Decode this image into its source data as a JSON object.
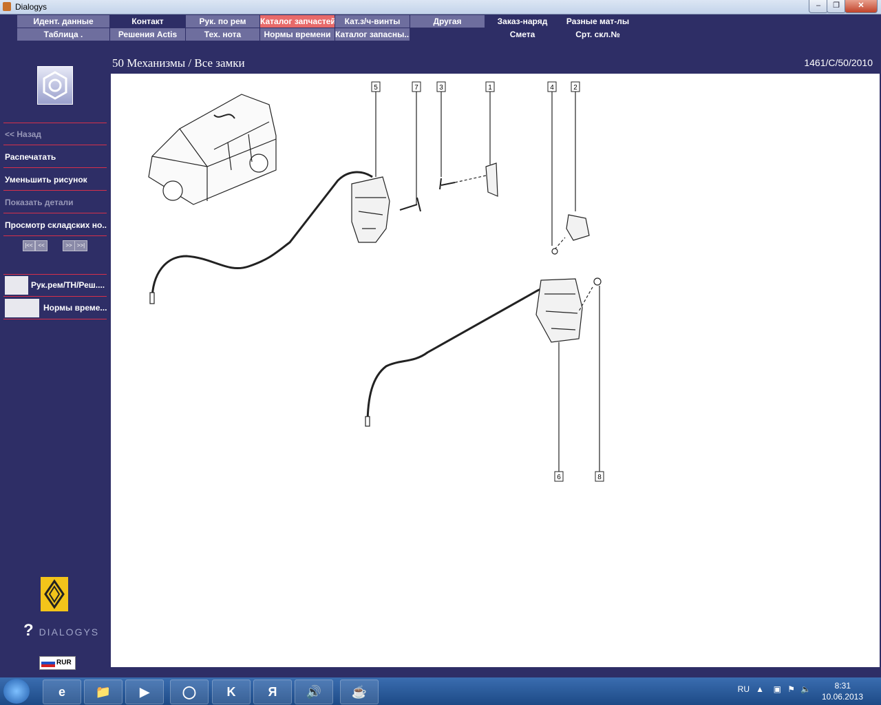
{
  "window": {
    "title": "Dialogys"
  },
  "menu": {
    "row1": [
      "Идент. данные",
      "Контакт",
      "Рук. по рем",
      "Каталог запчастей",
      "Кат.з/ч-винты",
      "Другая",
      "Заказ-наряд",
      "Разные мат-лы"
    ],
    "row2": [
      "Таблица .",
      "Решения Actis",
      "Тех. нота",
      "Нормы времени",
      "Каталог запасны...",
      "Смета",
      "Срт. скл.№"
    ],
    "active": "Каталог запчастей"
  },
  "header": {
    "breadcrumb": "50 Механизмы / Все замки",
    "reference": "1461/C/50/2010"
  },
  "sidebar": {
    "items": [
      {
        "label": "<< Назад"
      },
      {
        "label": "Распечатать"
      },
      {
        "label": "Уменьшить рисунок"
      },
      {
        "label": "Показать детали"
      },
      {
        "label": "Просмотр складских но..."
      }
    ],
    "pager": [
      "|<<",
      "<<",
      ">>",
      ">>|"
    ],
    "docs": [
      {
        "label": "Рук.рем/ТН/Реш...."
      },
      {
        "label": "Нормы време..."
      }
    ],
    "brand": "DIALOGYS",
    "currency": "RUR"
  },
  "diagram": {
    "callouts": [
      "5",
      "7",
      "3",
      "1",
      "4",
      "2",
      "6",
      "8"
    ]
  },
  "taskbar": {
    "language": "RU",
    "time": "8:31",
    "date": "10.06.2013"
  }
}
